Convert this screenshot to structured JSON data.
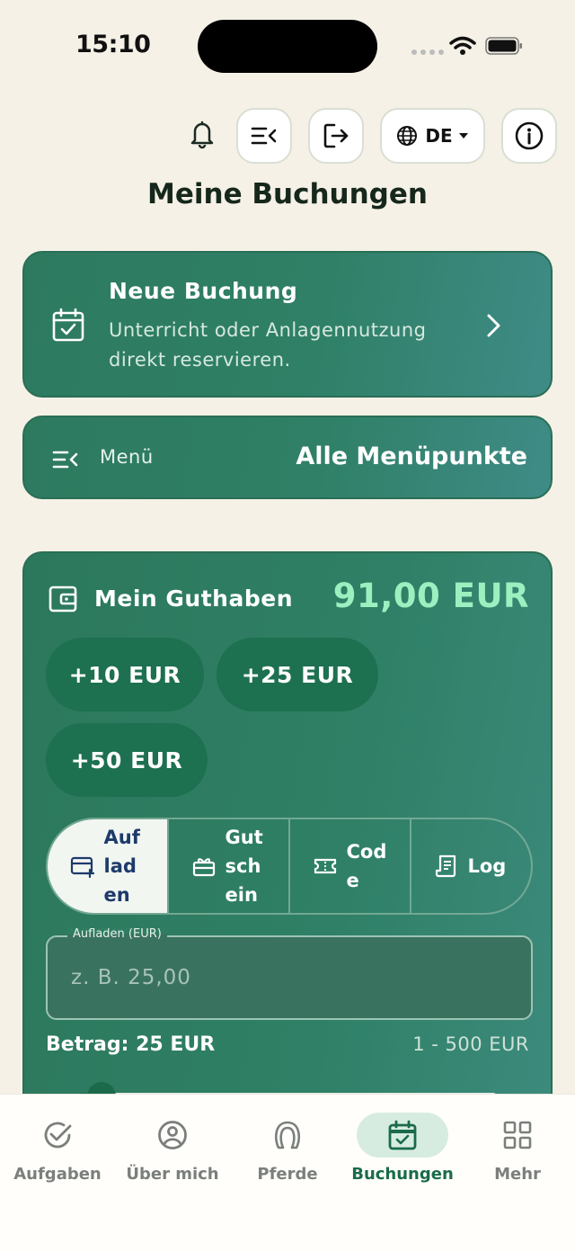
{
  "status_bar": {
    "time": "15:10"
  },
  "header": {
    "language": "DE",
    "title": "Meine Buchungen"
  },
  "new_booking": {
    "title": "Neue Buchung",
    "description": "Unterricht oder Anlagennutzung direkt reservieren."
  },
  "menu_card": {
    "label": "Menü",
    "action": "Alle Menüpunkte"
  },
  "wallet": {
    "title": "Mein Guthaben",
    "balance": "91,00 EUR",
    "quick_amounts": [
      "+10 EUR",
      "+25 EUR",
      "+50 EUR"
    ],
    "tabs": [
      {
        "label": "Aufladen",
        "icon": "card-plus-icon",
        "active": true
      },
      {
        "label": "Gutschein",
        "icon": "gift-card-icon",
        "active": false
      },
      {
        "label": "Code",
        "icon": "ticket-icon",
        "active": false
      },
      {
        "label": "Log",
        "icon": "receipt-icon",
        "active": false
      }
    ],
    "field_label": "Aufladen (EUR)",
    "field_placeholder": "z. B. 25,00",
    "amount_text": "Betrag: 25 EUR",
    "range_text": "1 - 500 EUR",
    "slider": {
      "min": 1,
      "max": 500,
      "value": 25
    }
  },
  "bottom_nav": [
    {
      "label": "Aufgaben",
      "icon": "check-circle-icon",
      "active": false
    },
    {
      "label": "Über mich",
      "icon": "user-circle-icon",
      "active": false
    },
    {
      "label": "Pferde",
      "icon": "horseshoe-icon",
      "active": false
    },
    {
      "label": "Buchungen",
      "icon": "calendar-check-icon",
      "active": true
    },
    {
      "label": "Mehr",
      "icon": "grid-icon",
      "active": false
    }
  ],
  "colors": {
    "background": "#f5f1e6",
    "card_green": "#2f8066",
    "accent_mint": "#9cf0c0",
    "active_nav": "#1a6a4b"
  }
}
